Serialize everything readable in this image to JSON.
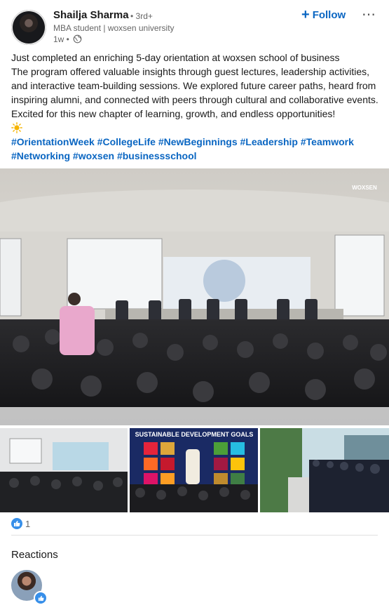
{
  "author": {
    "name": "Shailja Sharma",
    "degree": "• 3rd+",
    "headline": "MBA student | woxsen university",
    "time": "1w •"
  },
  "actions": {
    "follow_label": "Follow",
    "more_label": "⋯"
  },
  "post": {
    "lines": [
      "Just completed an enriching 5-day orientation at woxsen school of business",
      "The program offered valuable insights through guest lectures, leadership activities, and interactive team-building sessions. We explored future career paths, heard from inspiring alumni, and connected with peers through cultural and collaborative events. Excited for this new chapter of learning, growth, and endless opportunities!"
    ],
    "emoji": "sun-icon",
    "hashtags": [
      "#OrientationWeek",
      "#CollegeLife",
      "#NewBeginnings",
      "#Leadership",
      "#Teamwork",
      "#Networking",
      "#woxsen",
      "#businessschool"
    ]
  },
  "images": {
    "main_logo": "WOXSEN",
    "goals_title": "SUSTAINABLE DEVELOPMENT GOALS"
  },
  "reactions": {
    "count": "1",
    "title": "Reactions"
  },
  "colors": {
    "link": "#0a66c2",
    "like": "#378fe9",
    "muted": "#666666"
  }
}
